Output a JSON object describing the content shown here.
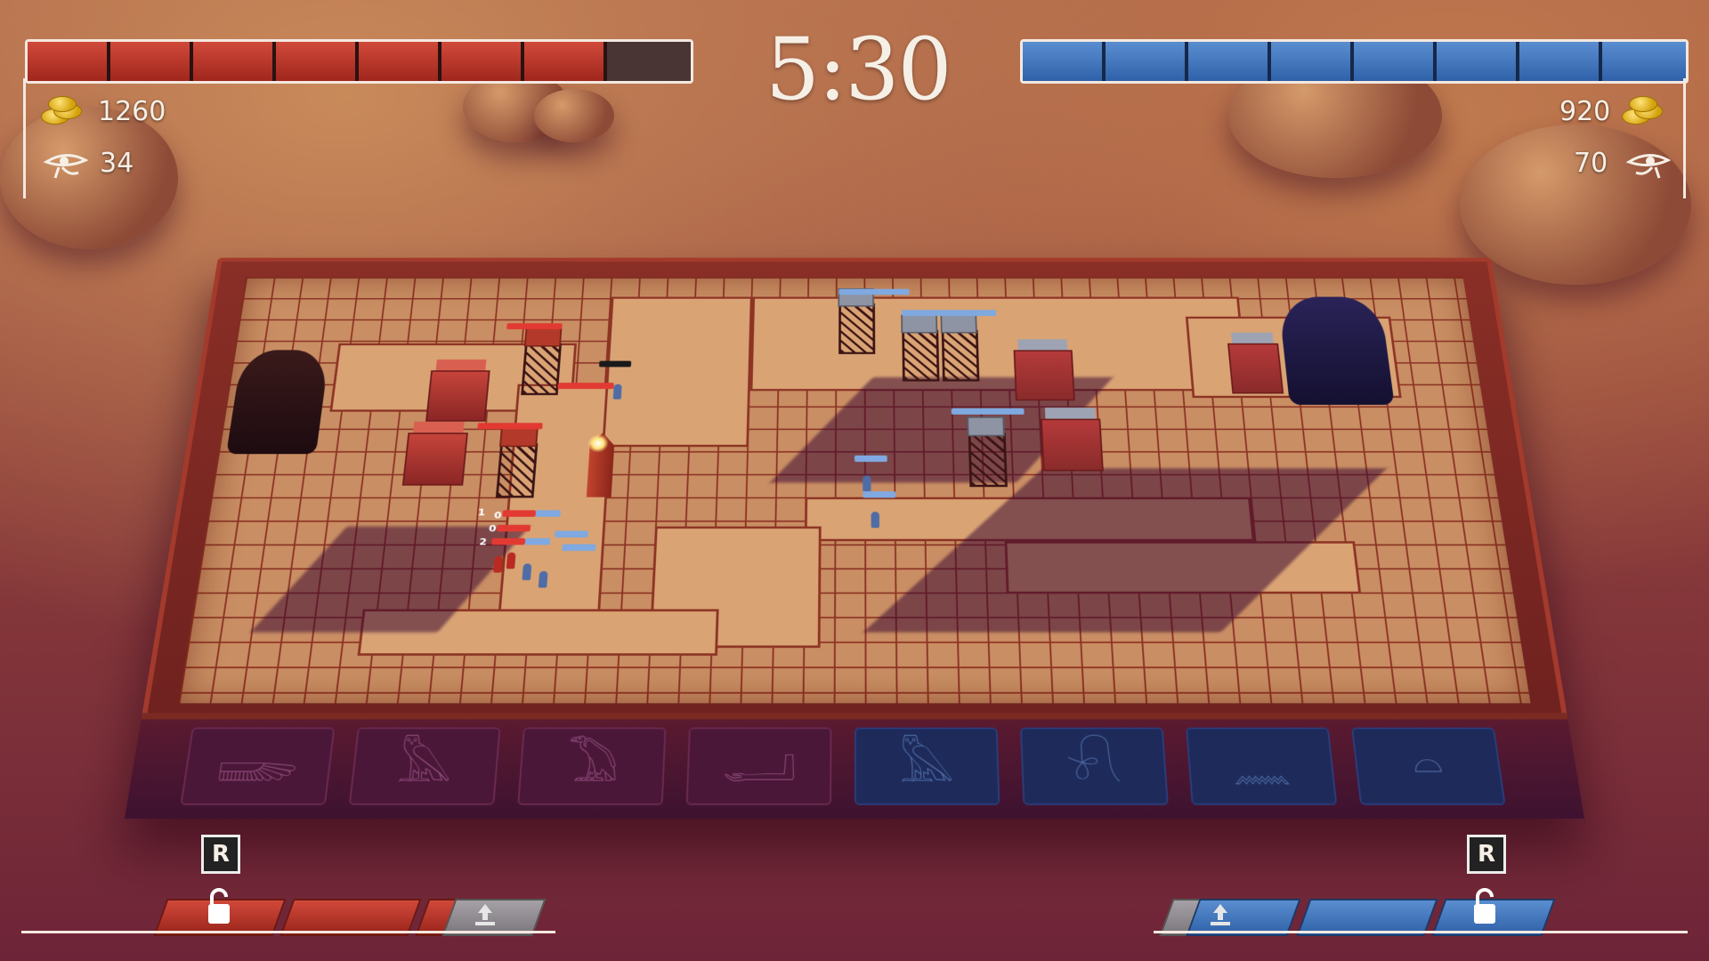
{
  "timer": "5:30",
  "red_player": {
    "gold": "1260",
    "vision": "34",
    "health_segments_total": 8,
    "health_segments_filled": 7,
    "health_fraction": 0.89,
    "color": "#c8392b"
  },
  "blue_player": {
    "gold": "920",
    "vision": "70",
    "health_segments_total": 8,
    "health_segments_filled": 8,
    "health_fraction": 1.0,
    "color": "#3f7cc4"
  },
  "abilities": {
    "red": {
      "key": "R"
    },
    "blue": {
      "key": "R"
    }
  },
  "unit_labels": [
    "1",
    "0",
    "0",
    "2"
  ],
  "icons": {
    "gold": "gold-coins-icon",
    "vision": "eye-of-horus-icon",
    "lock": "unlock-icon",
    "upload": "upload-icon"
  }
}
